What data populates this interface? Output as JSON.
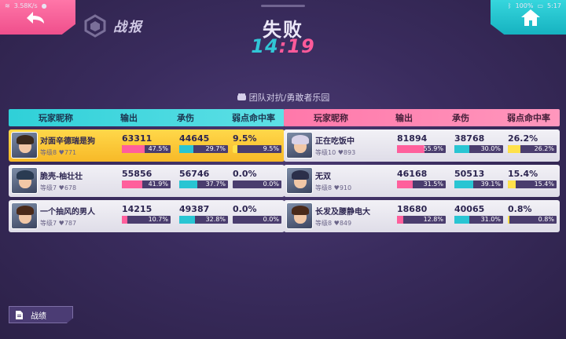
{
  "statusbar": {
    "speed": "3.58K/s",
    "battery": "100%",
    "time": "5:17"
  },
  "header": {
    "title": "战报",
    "result": "失败",
    "timer_min": "14",
    "timer_sep": ":",
    "timer_sec": "19"
  },
  "mode": "团队对抗/勇敢者乐园",
  "columns": {
    "name": "玩家昵称",
    "output": "输出",
    "tank": "承伤",
    "weak": "弱点命中率"
  },
  "teams": [
    {
      "side": "left",
      "players": [
        {
          "name": "对面辛德瑞是狗",
          "level": "等级8",
          "power": "771",
          "output": "63311",
          "output_pct": "47.5%",
          "output_frac": 0.475,
          "tank": "44645",
          "tank_pct": "29.7%",
          "tank_frac": 0.297,
          "weak": "9.5%",
          "weak_pct": "9.5%",
          "weak_frac": 0.095,
          "mvp": true,
          "hair": "#3b2a1e"
        },
        {
          "name": "脆壳-柚壮壮",
          "level": "等级7",
          "power": "678",
          "output": "55856",
          "output_pct": "41.9%",
          "output_frac": 0.419,
          "tank": "56746",
          "tank_pct": "37.7%",
          "tank_frac": 0.377,
          "weak": "0.0%",
          "weak_pct": "0.0%",
          "weak_frac": 0.0,
          "mvp": false,
          "hair": "#2a3b52"
        },
        {
          "name": "一个抽风的男人",
          "level": "等级7",
          "power": "787",
          "output": "14215",
          "output_pct": "10.7%",
          "output_frac": 0.107,
          "tank": "49387",
          "tank_pct": "32.8%",
          "tank_frac": 0.328,
          "weak": "0.0%",
          "weak_pct": "0.0%",
          "weak_frac": 0.0,
          "mvp": false,
          "hair": "#4a2a1a"
        }
      ]
    },
    {
      "side": "right",
      "players": [
        {
          "name": "正在吃饭中",
          "level": "等级10",
          "power": "893",
          "output": "81894",
          "output_pct": "55.9%",
          "output_frac": 0.559,
          "tank": "38768",
          "tank_pct": "30.0%",
          "tank_frac": 0.3,
          "weak": "26.2%",
          "weak_pct": "26.2%",
          "weak_frac": 0.262,
          "mvp": false,
          "hair": "#d8d2e8"
        },
        {
          "name": "无双",
          "level": "等级8",
          "power": "910",
          "output": "46168",
          "output_pct": "31.5%",
          "output_frac": 0.315,
          "tank": "50513",
          "tank_pct": "39.1%",
          "tank_frac": 0.391,
          "weak": "15.4%",
          "weak_pct": "15.4%",
          "weak_frac": 0.154,
          "mvp": false,
          "hair": "#2b2f4a"
        },
        {
          "name": "长发及腰静电大",
          "level": "等级8",
          "power": "849",
          "output": "18680",
          "output_pct": "12.8%",
          "output_frac": 0.128,
          "tank": "40065",
          "tank_pct": "31.0%",
          "tank_frac": 0.31,
          "weak": "0.8%",
          "weak_pct": "0.8%",
          "weak_frac": 0.008,
          "mvp": false,
          "hair": "#4a2a1a"
        }
      ]
    }
  ],
  "footer": {
    "record_label": "战绩"
  }
}
